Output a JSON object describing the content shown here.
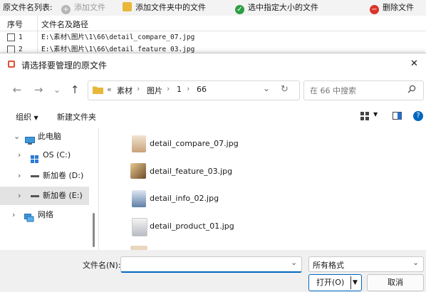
{
  "app": {
    "toolbar": {
      "list_label": "原文件名列表:",
      "add_file": "添加文件",
      "add_folder_files": "添加文件夹中的文件",
      "select_by_size": "选中指定大小的文件",
      "delete_files": "删除文件"
    },
    "table": {
      "col_index": "序号",
      "col_path": "文件名及路径",
      "rows": [
        {
          "index": "1",
          "path": "E:\\素材\\图片\\1\\66\\detail_compare_07.jpg"
        },
        {
          "index": "2",
          "path": "E:\\素材\\图片\\1\\66\\detail_feature_03.jpg"
        }
      ]
    }
  },
  "dialog": {
    "title": "请选择要管理的原文件",
    "close_glyph": "✕",
    "address": {
      "overflow": "«",
      "crumbs": [
        "素材",
        "图片",
        "1",
        "66"
      ],
      "separator": "›",
      "dropdown_glyph": "⌄",
      "refresh_glyph": "↻"
    },
    "search_placeholder": "在 66 中搜索",
    "commands": {
      "organize": "组织",
      "new_folder": "新建文件夹"
    },
    "nav": [
      {
        "label": "此电脑",
        "icon": "computer-icon"
      },
      {
        "label": "OS (C:)",
        "icon": "windows-drive-icon"
      },
      {
        "label": "新加卷 (D:)",
        "icon": "drive-icon"
      },
      {
        "label": "新加卷 (E:)",
        "icon": "drive-icon",
        "selected": true
      },
      {
        "label": "网络",
        "icon": "network-icon"
      }
    ],
    "files": [
      {
        "name": "detail_compare_07.jpg",
        "icon": "image-thumbnail-icon"
      },
      {
        "name": "detail_feature_03.jpg",
        "icon": "image-thumbnail-icon"
      },
      {
        "name": "detail_info_02.jpg",
        "icon": "image-thumbnail-icon"
      },
      {
        "name": "detail_product_01.jpg",
        "icon": "image-thumbnail-icon"
      }
    ],
    "filename_label": "文件名(N):",
    "filename_value": "",
    "filter_value": "所有格式",
    "open_button": "打开(O)",
    "cancel_button": "取消",
    "colors": {
      "accent": "#0067c0",
      "folder": "#e8b73a"
    }
  }
}
